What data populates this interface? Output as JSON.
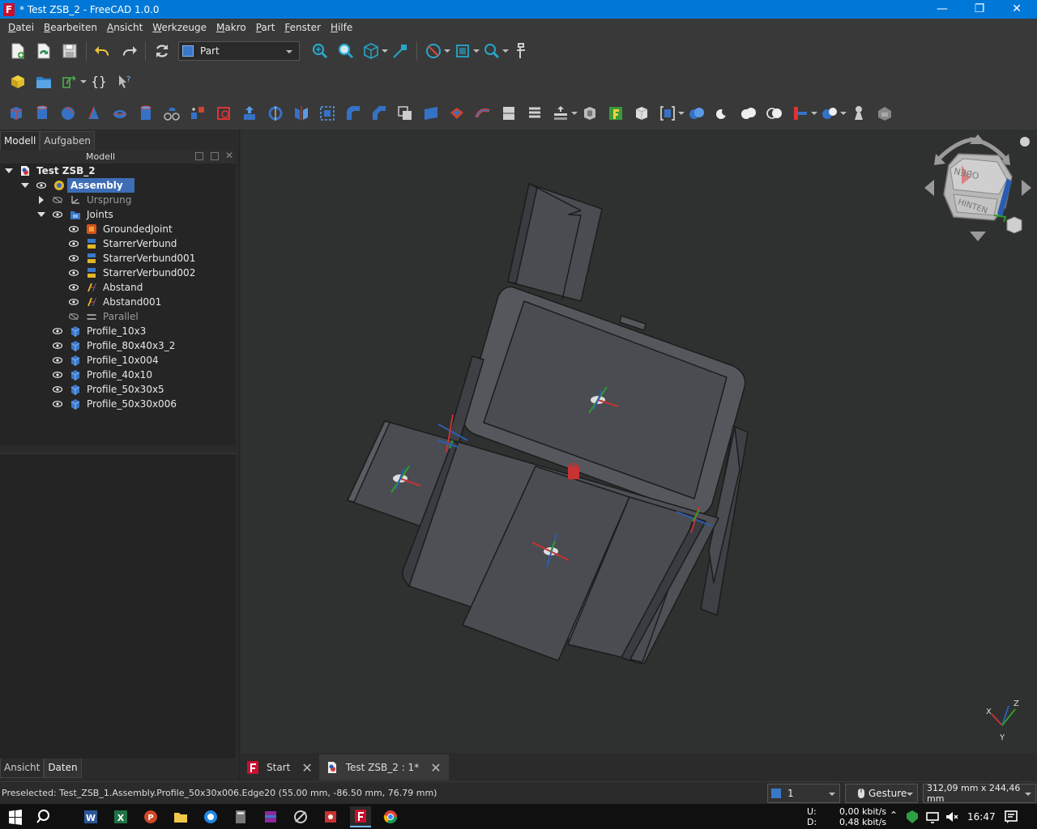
{
  "window": {
    "title": "* Test ZSB_2 - FreeCAD 1.0.0",
    "app_icon_letter": "F",
    "minimize": "—",
    "maximize": "❐",
    "close": "✕"
  },
  "menu": {
    "items": [
      {
        "accel": "D",
        "rest": "atei"
      },
      {
        "accel": "B",
        "rest": "earbeiten"
      },
      {
        "accel": "A",
        "rest": "nsicht"
      },
      {
        "accel": "W",
        "rest": "erkzeuge"
      },
      {
        "accel": "M",
        "rest": "akro"
      },
      {
        "accel": "P",
        "rest": "art"
      },
      {
        "accel": "F",
        "rest": "enster"
      },
      {
        "accel": "H",
        "rest": "ilfe"
      }
    ]
  },
  "toolbar": {
    "workbench": "Part",
    "macro_braces": "{}"
  },
  "left_panel": {
    "tabs": [
      "Modell",
      "Aufgaben"
    ],
    "header_title": "Modell",
    "bottom_tabs": [
      "Ansicht",
      "Daten"
    ]
  },
  "tree": {
    "root": "Test ZSB_2",
    "assembly": "Assembly",
    "origin": "Ursprung",
    "joints": "Joints",
    "joint_items": [
      "GroundedJoint",
      "StarrerVerbund",
      "StarrerVerbund001",
      "StarrerVerbund002",
      "Abstand",
      "Abstand001",
      "Parallel"
    ],
    "parts": [
      "Profile_10x3",
      "Profile_80x40x3_2",
      "Profile_10x004",
      "Profile_40x10",
      "Profile_50x30x5",
      "Profile_50x30x006"
    ]
  },
  "navcube": {
    "top_face": "OBEN",
    "front_face": "HINTEN"
  },
  "axis": {
    "x": "X",
    "y": "Y",
    "z": "Z"
  },
  "doc_tabs": {
    "start": "Start",
    "doc": "Test ZSB_2 : 1*"
  },
  "status": {
    "message": "Preselected: Test_ZSB_1.Assembly.Profile_50x30x006.Edge20 (55.00 mm, -86.50 mm, 76.79 mm)",
    "page": "1",
    "navigation_style": "Gesture",
    "dimensions": "312,09 mm x 244,46 mm"
  },
  "taskbar": {
    "net_up_label": "U:",
    "net_down_label": "D:",
    "net_up": "0,00 kbit/s",
    "net_down": "0,48 kbit/s",
    "time": "16:47"
  },
  "colors": {
    "titlebar": "#0078d7",
    "selection": "#3d6db5",
    "model_fill": "#4a4c52",
    "viewport_bg": "#2f3030"
  }
}
